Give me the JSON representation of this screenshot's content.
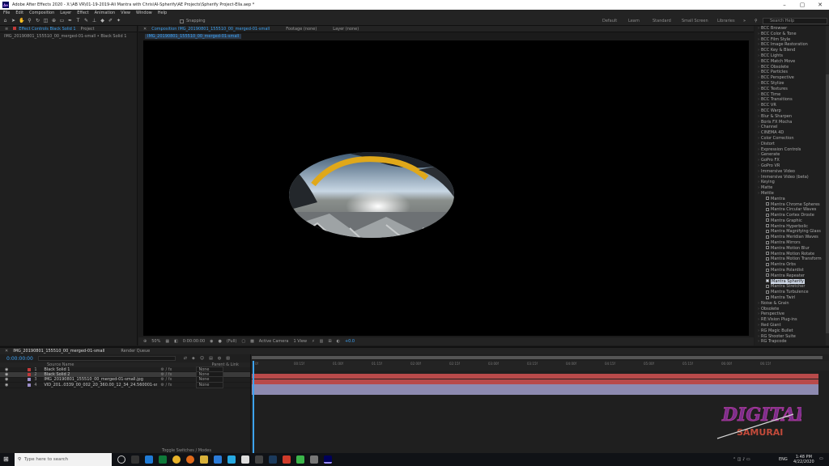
{
  "titlebar": {
    "app_icon": "Ae",
    "title": "Adobe After Effects 2020 - X:\\AB VR\\01-19-2019-Ali Mantra with Chris\\AI-Spherify\\AE Projects\\Spherify Project-Ella.aep *"
  },
  "menu": [
    "File",
    "Edit",
    "Composition",
    "Layer",
    "Effect",
    "Animation",
    "View",
    "Window",
    "Help"
  ],
  "toolbar": {
    "snapping_label": "Snapping",
    "workspaces": [
      "Default",
      "Learn",
      "Standard",
      "Small Screen",
      "Libraries"
    ],
    "search_placeholder": "Search Help"
  },
  "left_panel": {
    "tab_effect_controls": "Effect Controls Black Solid 1",
    "tab_project": "Project",
    "subtitle": "IMG_20190801_155510_00_merged-01-small • Black Solid 1"
  },
  "comp_panel": {
    "tab_composition": "Composition IMG_20190801_155510_00_merged-01-small",
    "tab_footage": "Footage (none)",
    "tab_layer": "Layer (none)",
    "breadcrumb": "IMG_20190801_155510_00_merged-01-small",
    "footer": {
      "zoom": "50%",
      "timecode": "0:00:00:00",
      "resolution": "(Full)",
      "camera": "Active Camera",
      "views": "1 View",
      "exposure": "+0.0"
    }
  },
  "effects_panel": {
    "items": [
      {
        "label": "BCC Browser",
        "sub": false
      },
      {
        "label": "BCC Color & Tone",
        "sub": false
      },
      {
        "label": "BCC Film Style",
        "sub": false
      },
      {
        "label": "BCC Image Restoration",
        "sub": false
      },
      {
        "label": "BCC Key & Blend",
        "sub": false
      },
      {
        "label": "BCC Lights",
        "sub": false
      },
      {
        "label": "BCC Match Move",
        "sub": false
      },
      {
        "label": "BCC Obsolete",
        "sub": false
      },
      {
        "label": "BCC Particles",
        "sub": false
      },
      {
        "label": "BCC Perspective",
        "sub": false
      },
      {
        "label": "BCC Stylize",
        "sub": false
      },
      {
        "label": "BCC Textures",
        "sub": false
      },
      {
        "label": "BCC Time",
        "sub": false
      },
      {
        "label": "BCC Transitions",
        "sub": false
      },
      {
        "label": "BCC VR",
        "sub": false
      },
      {
        "label": "BCC Warp",
        "sub": false
      },
      {
        "label": "Blur & Sharpen",
        "sub": false
      },
      {
        "label": "Boris FX Mocha",
        "sub": false
      },
      {
        "label": "Channel",
        "sub": false
      },
      {
        "label": "CINEMA 4D",
        "sub": false
      },
      {
        "label": "Color Correction",
        "sub": false
      },
      {
        "label": "Distort",
        "sub": false
      },
      {
        "label": "Expression Controls",
        "sub": false
      },
      {
        "label": "Generate",
        "sub": false
      },
      {
        "label": "GoPro FX",
        "sub": false
      },
      {
        "label": "GoPro VR",
        "sub": false
      },
      {
        "label": "Immersive Video",
        "sub": false
      },
      {
        "label": "Immersive Video (beta)",
        "sub": false
      },
      {
        "label": "Keying",
        "sub": false
      },
      {
        "label": "Matte",
        "sub": false
      },
      {
        "label": "Mettle",
        "sub": false
      },
      {
        "label": "Mantra",
        "sub": true
      },
      {
        "label": "Mantra Chrome Spheres",
        "sub": true
      },
      {
        "label": "Mantra Circular Waves",
        "sub": true
      },
      {
        "label": "Mantra Cortex Droste",
        "sub": true
      },
      {
        "label": "Mantra Graphic",
        "sub": true
      },
      {
        "label": "Mantra Hyperbolic",
        "sub": true
      },
      {
        "label": "Mantra Magnifying Glass",
        "sub": true
      },
      {
        "label": "Mantra Meridian Waves",
        "sub": true
      },
      {
        "label": "Mantra Mirrors",
        "sub": true
      },
      {
        "label": "Mantra Motion Blur",
        "sub": true
      },
      {
        "label": "Mantra Motion Rotate",
        "sub": true
      },
      {
        "label": "Mantra Motion Transform",
        "sub": true
      },
      {
        "label": "Mantra Orbs",
        "sub": true
      },
      {
        "label": "Mantra Polardist",
        "sub": true
      },
      {
        "label": "Mantra Repeater",
        "sub": true
      },
      {
        "label": "Mantra Spherify",
        "sub": true,
        "selected": true
      },
      {
        "label": "Mantra Stretcher",
        "sub": true
      },
      {
        "label": "Mantra Turbulence",
        "sub": true
      },
      {
        "label": "Mantra Twirl",
        "sub": true
      },
      {
        "label": "Noise & Grain",
        "sub": false
      },
      {
        "label": "Obsolete",
        "sub": false
      },
      {
        "label": "Perspective",
        "sub": false
      },
      {
        "label": "RE:Vision Plug-ins",
        "sub": false
      },
      {
        "label": "Red Giant",
        "sub": false
      },
      {
        "label": "RG Magic Bullet",
        "sub": false
      },
      {
        "label": "RG Shooter Suite",
        "sub": false
      },
      {
        "label": "RG Trapcode",
        "sub": false
      }
    ]
  },
  "timeline": {
    "tab": "IMG_20190801_155510_00_merged-01-small",
    "render_queue": "Render Queue",
    "timecode": "0:00:00:00",
    "col_source": "Source Name",
    "col_parent": "Parent & Link",
    "layers": [
      {
        "num": "1",
        "name": "Black Solid 1",
        "color": "#c23a3a",
        "parent": "None",
        "bar": "#b84a4a"
      },
      {
        "num": "2",
        "name": "Black Solid 2",
        "color": "#c23a3a",
        "parent": "None",
        "bar": "#b84a4a"
      },
      {
        "num": "3",
        "name": "IMG_20190801_155510_00_merged-01-small.jpg",
        "color": "#9b8ec9",
        "parent": "None",
        "bar": "#8d8ab0"
      },
      {
        "num": "4",
        "name": "VID_201..0339_00_002_20_360.00_12_34_24.560001-small.jp",
        "color": "#9b8ec9",
        "parent": "None",
        "bar": "#8d8ab0"
      }
    ],
    "ruler_ticks": [
      "0f",
      "00:15f",
      "01:00f",
      "01:15f",
      "02:00f",
      "02:15f",
      "03:00f",
      "03:15f",
      "04:00f",
      "04:15f",
      "05:00f",
      "05:15f",
      "06:00f",
      "06:15f"
    ],
    "toggle_label": "Toggle Switches / Modes"
  },
  "taskbar": {
    "search_placeholder": "Type here to search",
    "time": "1:48 PM",
    "date": "4/22/2020",
    "lang": "ENG"
  },
  "watermark": {
    "line1": "DIGITAL",
    "line2": "SAMURAI"
  },
  "colors": {
    "accent_blue": "#3da3f5",
    "label_red": "#c23a3a",
    "label_purple": "#9b8ec9",
    "playhead": "#3da3f5"
  }
}
